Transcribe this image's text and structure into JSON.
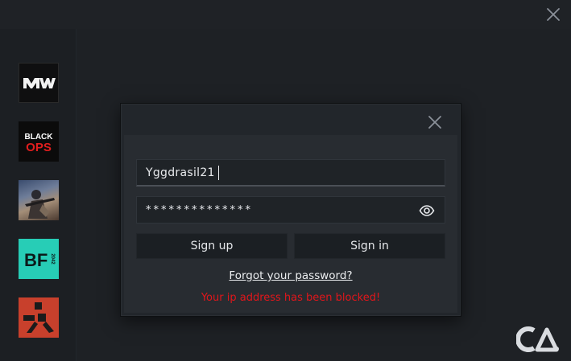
{
  "app": {
    "games": [
      {
        "name": "MW",
        "icon": "modern-warfare-logo"
      },
      {
        "name": "BLACK OPS",
        "line1": "BLACK",
        "line2": "OPS",
        "icon": "black-ops-logo"
      },
      {
        "name": "game-artwork",
        "icon": "soldier-artwork"
      },
      {
        "name": "BF 2042",
        "line1": "BF",
        "line2": "2042",
        "icon": "battlefield-2042-logo"
      },
      {
        "name": "Rust",
        "icon": "rust-logo"
      }
    ]
  },
  "login": {
    "username_value": "Yggdrasil21",
    "password_masked": "**************",
    "signup_label": "Sign up",
    "signin_label": "Sign in",
    "forgot_label": "Forgot your password?",
    "error_message": "Your ip address has been blocked!"
  },
  "colors": {
    "background": "#1b1e22",
    "dialog": "#22262b",
    "error": "#e0161b",
    "bf_tile": "#27cdb6",
    "rust_tile": "#c8402c"
  }
}
